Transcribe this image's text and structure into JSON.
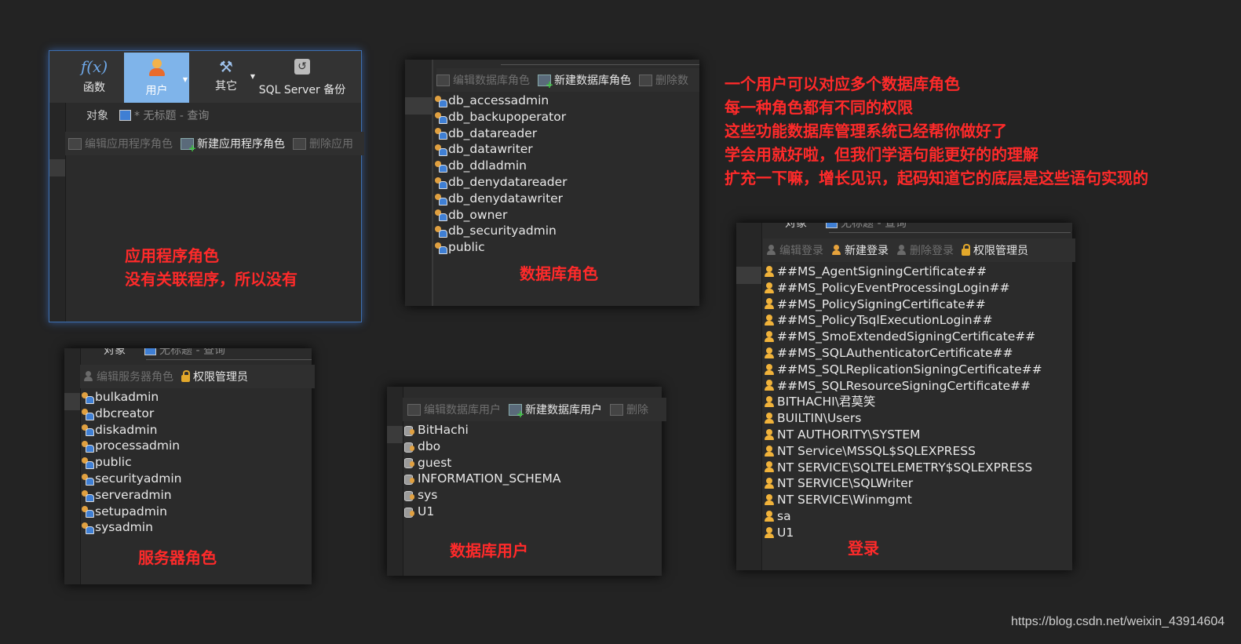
{
  "panel_app_roles": {
    "ribbon": [
      {
        "label": "函数",
        "icon": "function-icon"
      },
      {
        "label": "用户",
        "icon": "user-icon"
      },
      {
        "label": "其它",
        "icon": "tools-icon"
      },
      {
        "label": "SQL Server 备份",
        "icon": "backup-icon"
      }
    ],
    "tab_object": "对象",
    "tab_query": "* 无标题 - 查询",
    "toolbar": {
      "edit": "编辑应用程序角色",
      "new": "新建应用程序角色",
      "delete": "删除应用"
    },
    "annotation": [
      "应用程序角色",
      "没有关联程序，所以没有"
    ]
  },
  "panel_db_roles": {
    "toolbar": {
      "edit": "编辑数据库角色",
      "new": "新建数据库角色",
      "delete": "删除数"
    },
    "items": [
      "db_accessadmin",
      "db_backupoperator",
      "db_datareader",
      "db_datawriter",
      "db_ddladmin",
      "db_denydatareader",
      "db_denydatawriter",
      "db_owner",
      "db_securityadmin",
      "public"
    ],
    "annotation": "数据库角色"
  },
  "panel_server_roles": {
    "tab_object": "对象",
    "tab_query": "无标题 - 查询",
    "toolbar": {
      "edit": "编辑服务器角色",
      "admin": "权限管理员"
    },
    "items": [
      "bulkadmin",
      "dbcreator",
      "diskadmin",
      "processadmin",
      "public",
      "securityadmin",
      "serveradmin",
      "setupadmin",
      "sysadmin"
    ],
    "annotation": "服务器角色"
  },
  "panel_db_users": {
    "toolbar": {
      "edit": "编辑数据库用户",
      "new": "新建数据库用户",
      "delete": "删除"
    },
    "items": [
      "BitHachi",
      "dbo",
      "guest",
      "INFORMATION_SCHEMA",
      "sys",
      "U1"
    ],
    "annotation": "数据库用户"
  },
  "panel_logins": {
    "tab_object": "对象",
    "tab_query": "无标题 - 查询",
    "toolbar": {
      "edit": "编辑登录",
      "new": "新建登录",
      "delete": "删除登录",
      "admin": "权限管理员"
    },
    "items": [
      "##MS_AgentSigningCertificate##",
      "##MS_PolicyEventProcessingLogin##",
      "##MS_PolicySigningCertificate##",
      "##MS_PolicyTsqlExecutionLogin##",
      "##MS_SmoExtendedSigningCertificate##",
      "##MS_SQLAuthenticatorCertificate##",
      "##MS_SQLReplicationSigningCertificate##",
      "##MS_SQLResourceSigningCertificate##",
      "BITHACHI\\君莫笑",
      "BUILTIN\\Users",
      "NT AUTHORITY\\SYSTEM",
      "NT Service\\MSSQL$SQLEXPRESS",
      "NT SERVICE\\SQLTELEMETRY$SQLEXPRESS",
      "NT SERVICE\\SQLWriter",
      "NT SERVICE\\Winmgmt",
      "sa",
      "U1"
    ],
    "annotation": "登录"
  },
  "notes": [
    "一个用户可以对应多个数据库角色",
    "每一种角色都有不同的权限",
    "这些功能数据库管理系统已经帮你做好了",
    "学会用就好啦，但我们学语句能更好的的理解",
    "扩充一下嘛，增长见识，起码知道它的底层是这些语句实现的"
  ],
  "watermark": "https://blog.csdn.net/weixin_43914604",
  "colors": {
    "annotation": "#ff2a2a",
    "background": "#232323",
    "ribbon_active": "#7fb4ea"
  }
}
